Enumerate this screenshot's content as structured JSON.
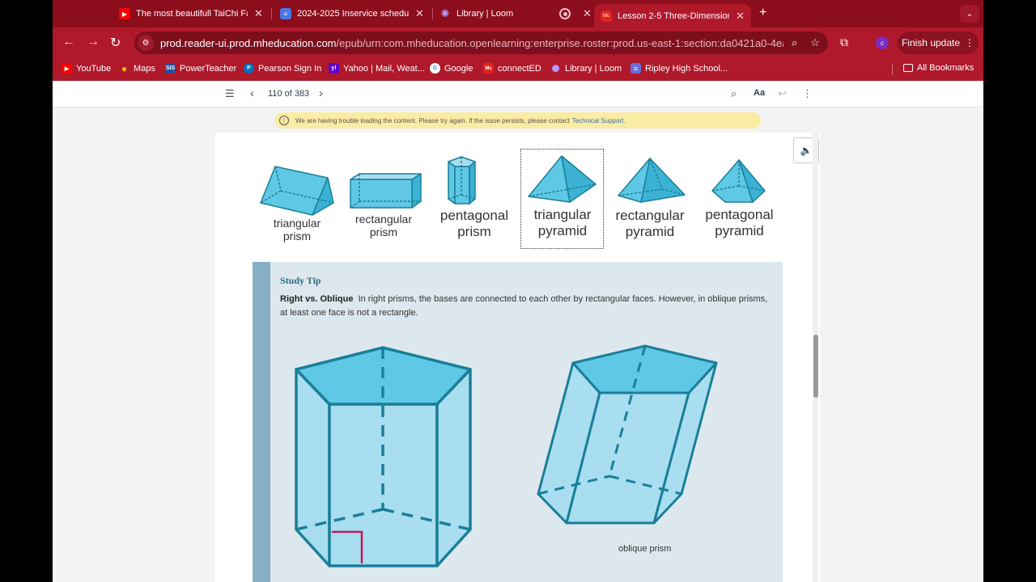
{
  "tabs": [
    {
      "title": "The most beautifull TaiChi Fa",
      "icon": "youtube-icon",
      "color": "#ff0000"
    },
    {
      "title": "2024-2025 Inservice schedul",
      "icon": "docs-icon",
      "color": "#4a78e8"
    },
    {
      "title": "Library | Loom",
      "icon": "loom-icon",
      "color": "#6f5cff"
    },
    {
      "title": "",
      "icon": "record-icon",
      "color": "#b0182b"
    },
    {
      "title": "Lesson 2-5 Three-Dimension",
      "icon": "mheducation-icon",
      "color": "#e2231a",
      "active": true
    }
  ],
  "toolbar": {
    "url_host": "prod.reader-ui.prod.mheducation.com",
    "url_path": "/epub/urn:com.mheducation.openlearning:enterprise.roster:prod.us-east-1:section:da0421a0-4eac-...",
    "avatar_letter": "c",
    "finish_label": "Finish update"
  },
  "bookmarks": [
    {
      "label": "YouTube",
      "icon": "youtube-icon",
      "color": "#ff0000"
    },
    {
      "label": "Maps",
      "icon": "maps-icon",
      "color": "#34a853"
    },
    {
      "label": "PowerTeacher",
      "icon": "sis-icon",
      "color": "#2b4a9c",
      "badge": "SIS"
    },
    {
      "label": "Pearson Sign In",
      "icon": "pearson-icon",
      "color": "#0072bc",
      "badge": "P"
    },
    {
      "label": "Yahoo | Mail, Weat...",
      "icon": "yahoo-icon",
      "color": "#5f01d1",
      "badge": "y!"
    },
    {
      "label": "Google",
      "icon": "google-icon",
      "color": "#ffffff",
      "badge": "G"
    },
    {
      "label": "connectED",
      "icon": "mheducation-icon",
      "color": "#e2231a",
      "badge": "Mc"
    },
    {
      "label": "Library | Loom",
      "icon": "loom-icon",
      "color": "#6f5cff",
      "badge": "✺"
    },
    {
      "label": "Ripley High School...",
      "icon": "list-icon",
      "color": "#6b6bdd",
      "badge": "≡"
    }
  ],
  "all_bookmarks": "All Bookmarks",
  "reader": {
    "page_count": "110 of 383",
    "font_label": "Aa"
  },
  "warning": {
    "text": "We are having trouble loading the content. Please try again. If the issue persists, please contact",
    "link": "Technical Support."
  },
  "solids": [
    {
      "name": "triangular prism",
      "line1": "triangular",
      "line2": "prism"
    },
    {
      "name": "rectangular prism",
      "line1": "rectangular",
      "line2": "prism"
    },
    {
      "name": "pentagonal prism",
      "line1": "pentagonal",
      "line2": "prism"
    },
    {
      "name": "triangular pyramid",
      "line1": "triangular",
      "line2": "pyramid"
    },
    {
      "name": "rectangular pyramid",
      "line1": "rectangular",
      "line2": "pyramid"
    },
    {
      "name": "pentagonal pyramid",
      "line1": "pentagonal",
      "line2": "pyramid"
    }
  ],
  "study_tip": {
    "title": "Study Tip",
    "bold": "Right vs. Oblique",
    "text": "In right prisms, the bases are connected to each other by rectangular faces. However, in oblique prisms, at least one face is not a rectangle.",
    "oblique_label": "oblique prism"
  },
  "colors": {
    "face": "#5ec8e5",
    "face_light": "#a8def0",
    "edge": "#1a7f98",
    "chrome": "#b0182b",
    "tab_strip": "#8c0d1c"
  }
}
